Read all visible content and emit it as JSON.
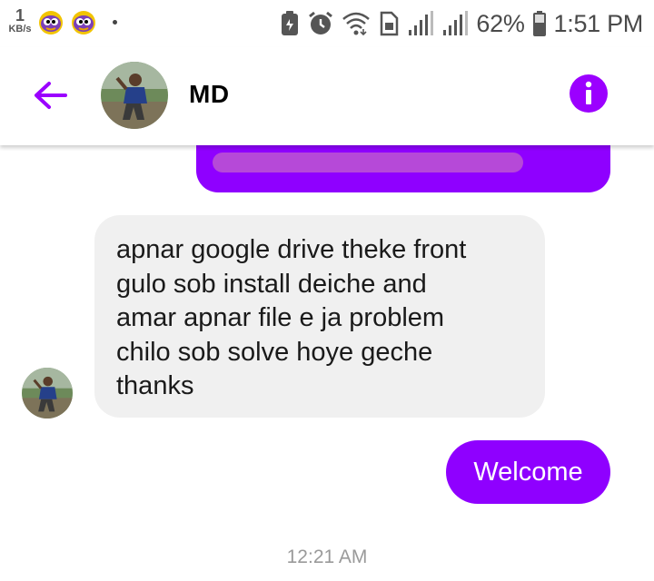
{
  "status_bar": {
    "net_speed_value": "1",
    "net_speed_unit": "KB/s",
    "battery_percent": "62%",
    "time": "1:51 PM",
    "icons": [
      "app-notification-icon",
      "app-notification-icon",
      "notification-dot",
      "battery-saver-icon",
      "alarm-icon",
      "wifi-icon",
      "sim-icon",
      "signal-icon",
      "signal-icon",
      "battery-icon"
    ]
  },
  "header": {
    "contact_name": "MD",
    "back_icon": "arrow-left-icon",
    "info_icon": "info-icon",
    "accent_color": "#9b00ff"
  },
  "messages": {
    "received_text": "apnar google drive theke front\ngulo sob install deiche and\namar apnar file e ja problem\nchilo sob solve hoye geche\nthanks",
    "sent_text": "Welcome",
    "timestamp": "12:21 AM"
  },
  "colors": {
    "sent_bubble": "#8f00ff",
    "received_bubble": "#f0f0f0",
    "timestamp": "#9a9a9a"
  }
}
